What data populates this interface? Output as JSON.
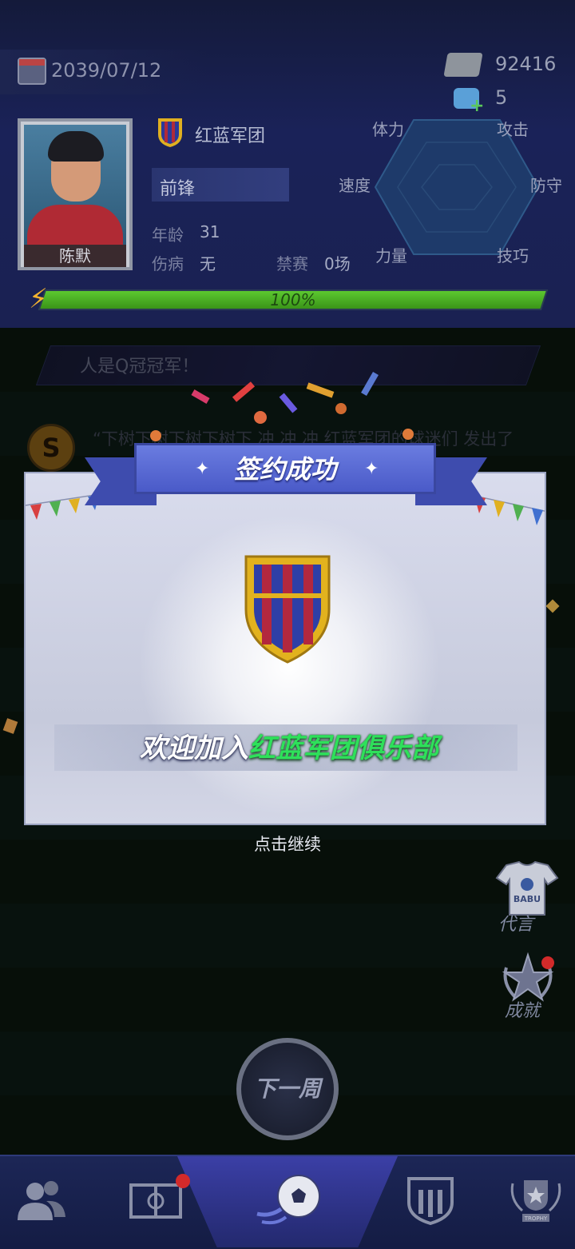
{
  "header": {
    "date": "2039/07/12",
    "money": "92416",
    "gems": "5",
    "gem_plus": "+"
  },
  "player": {
    "name": "陈默",
    "club": "红蓝军团",
    "position": "前锋",
    "age_label": "年龄",
    "age": "31",
    "injury_label": "伤病",
    "injury": "无",
    "ban_label": "禁赛",
    "ban": "0场",
    "energy": "100%",
    "energy_fraction": 1.0
  },
  "stats": {
    "stamina": "体力",
    "attack": "攻击",
    "speed": "速度",
    "defense": "防守",
    "strength": "力量",
    "technique": "技巧"
  },
  "ticker": "人是Q冠冠军！",
  "news": {
    "icon_letter": "S",
    "text": "“下树下树下树下树下 冲 冲 冲 红蓝军团的球迷们 发出了"
  },
  "modal": {
    "title": "签约成功",
    "welcome_prefix": "欢迎加入",
    "welcome_club": "红蓝军团俱乐部",
    "continue": "点击继续"
  },
  "side_buttons": {
    "endorse": "代言",
    "endorse_shirt_text": "BABU",
    "achievements": "成就"
  },
  "next_week": "下一周",
  "nav": {
    "items": [
      "team-icon",
      "field-icon",
      "ball-icon",
      "club-icon",
      "trophy-icon"
    ],
    "trophy_text": "TROPHY"
  },
  "colors": {
    "accent_blue": "#4a5ac8",
    "energy_green": "#5cc830",
    "club_green": "#2ee05a",
    "alert_red": "#d22a2a"
  }
}
